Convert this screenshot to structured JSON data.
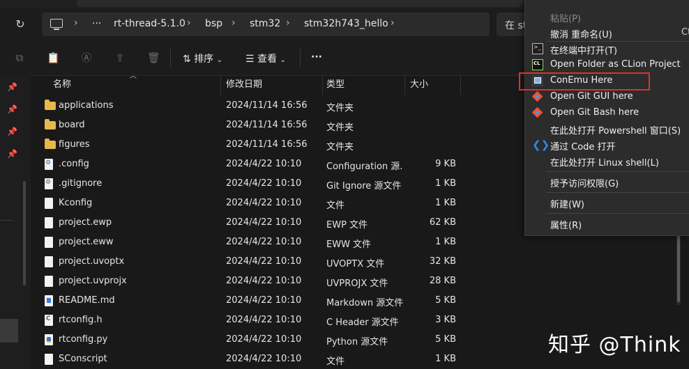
{
  "address": {
    "crumbs": [
      "rt-thread-5.1.0",
      "bsp",
      "stm32",
      "stm32h743_hello"
    ],
    "overflow": "···",
    "separator": "›",
    "search_placeholder": "在 st"
  },
  "toolbar": {
    "sort_label": "排序",
    "view_label": "查看",
    "more": "···"
  },
  "columns": {
    "name": "名称",
    "date": "修改日期",
    "type": "类型",
    "size": "大小"
  },
  "files": [
    {
      "name": "applications",
      "date": "2024/11/14 16:56",
      "type": "文件夹",
      "size": "",
      "icon": "folder"
    },
    {
      "name": "board",
      "date": "2024/11/14 16:56",
      "type": "文件夹",
      "size": "",
      "icon": "folder"
    },
    {
      "name": "figures",
      "date": "2024/11/14 16:56",
      "type": "文件夹",
      "size": "",
      "icon": "folder"
    },
    {
      "name": ".config",
      "date": "2024/4/22 10:10",
      "type": "Configuration 源...",
      "size": "9 KB",
      "icon": "gear"
    },
    {
      "name": ".gitignore",
      "date": "2024/4/22 10:10",
      "type": "Git Ignore 源文件",
      "size": "1 KB",
      "icon": "gear"
    },
    {
      "name": "Kconfig",
      "date": "2024/4/22 10:10",
      "type": "文件",
      "size": "1 KB",
      "icon": "file"
    },
    {
      "name": "project.ewp",
      "date": "2024/4/22 10:10",
      "type": "EWP 文件",
      "size": "62 KB",
      "icon": "file"
    },
    {
      "name": "project.eww",
      "date": "2024/4/22 10:10",
      "type": "EWW 文件",
      "size": "1 KB",
      "icon": "file"
    },
    {
      "name": "project.uvoptx",
      "date": "2024/4/22 10:10",
      "type": "UVOPTX 文件",
      "size": "32 KB",
      "icon": "file"
    },
    {
      "name": "project.uvprojx",
      "date": "2024/4/22 10:10",
      "type": "UVPROJX 文件",
      "size": "28 KB",
      "icon": "file"
    },
    {
      "name": "README.md",
      "date": "2024/4/22 10:10",
      "type": "Markdown 源文件",
      "size": "5 KB",
      "icon": "md"
    },
    {
      "name": "rtconfig.h",
      "date": "2024/4/22 10:10",
      "type": "C Header 源文件",
      "size": "3 KB",
      "icon": "c"
    },
    {
      "name": "rtconfig.py",
      "date": "2024/4/22 10:10",
      "type": "Python 源文件",
      "size": "5 KB",
      "icon": "py"
    },
    {
      "name": "SConscript",
      "date": "2024/4/22 10:10",
      "type": "文件",
      "size": "1 KB",
      "icon": "file"
    }
  ],
  "context_menu": {
    "paste": "粘贴(P)",
    "undo": "撤消 重命名(U)",
    "undo_shortcut": "Ct",
    "terminal": "在终端中打开(T)",
    "clion": "Open Folder as CLion Project",
    "conemu": "ConEmu Here",
    "git_gui": "Open Git GUI here",
    "git_bash": "Open Git Bash here",
    "powershell": "在此处打开 Powershell 窗口(S)",
    "vscode": "通过 Code 打开",
    "linux_shell": "在此处打开 Linux shell(L)",
    "grant_access": "授予访问权限(G)",
    "new": "新建(W)",
    "properties": "属性(R)"
  },
  "watermark": "知乎 @Think",
  "colors": {
    "highlight_border": "#d9342b",
    "folder": "#e8b84a",
    "background": "#191919",
    "menu_bg": "#2c2c2c"
  }
}
